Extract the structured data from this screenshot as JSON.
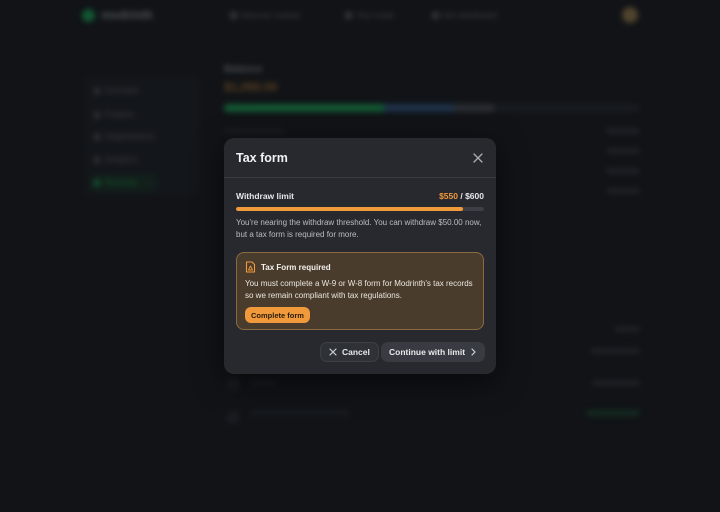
{
  "background": {
    "app_name": "modrinth",
    "nav": [
      "Discover content",
      "Your mods",
      "Dev dashboard"
    ],
    "sidebar": [
      "Overview",
      "Projects",
      "Organizations",
      "Analytics",
      "Revenue"
    ],
    "balance_label": "Balance",
    "balance_value": "$1,050.00",
    "transactions": [
      "Transfer",
      "Remaining balance"
    ]
  },
  "modal": {
    "title": "Tax form",
    "limit_label": "Withdraw limit",
    "limit_used": "$550",
    "limit_sep": " / ",
    "limit_max": "$600",
    "limit_progress": 0.917,
    "note": "You're nearing the withdraw threshold. You can withdraw $50.00 now, but a tax form is required for more.",
    "alert": {
      "title": "Tax Form required",
      "body": "You must complete a W-9 or W-8 form for Modrinth's tax records so we remain compliant with tax regulations.",
      "button": "Complete form"
    },
    "cancel_label": "Cancel",
    "continue_label": "Continue with limit"
  },
  "colors": {
    "accent_orange": "#f09a3c",
    "brand_green": "#1bd96a",
    "modal_bg": "#27292e"
  }
}
